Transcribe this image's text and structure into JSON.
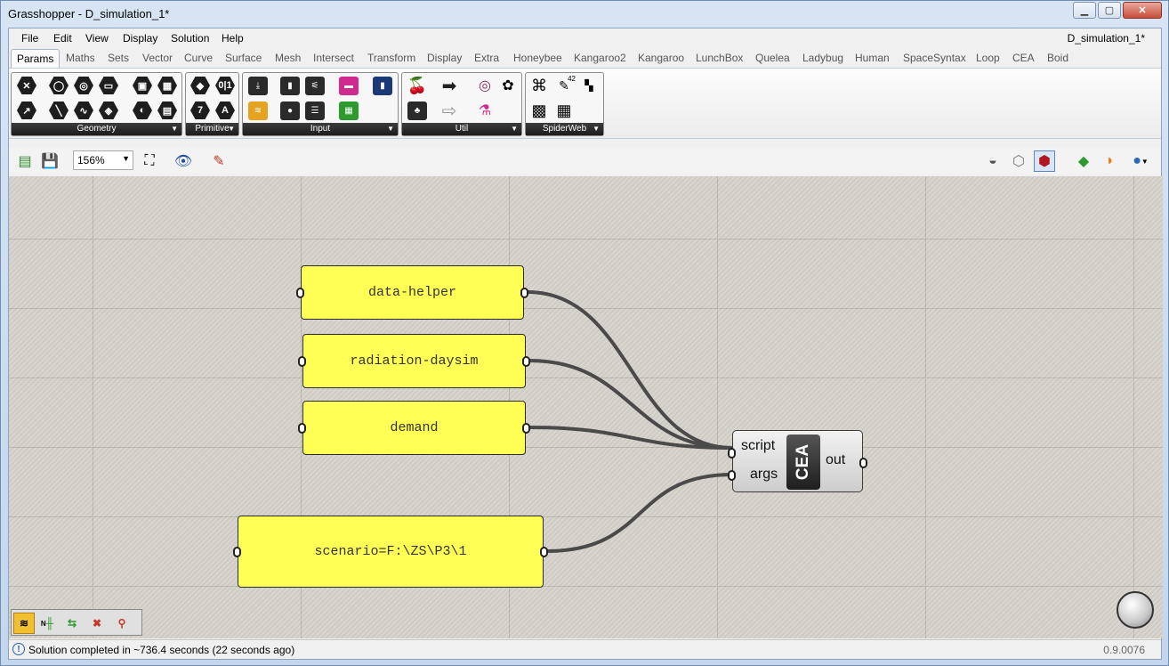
{
  "window": {
    "title": "Grasshopper - D_simulation_1*",
    "minimize_label": "▁",
    "maximize_label": "▢",
    "close_label": "✕"
  },
  "menu": {
    "items": [
      "File",
      "Edit",
      "View",
      "Display",
      "Solution",
      "Help"
    ],
    "document_name": "D_simulation_1*"
  },
  "tabs": [
    "Params",
    "Maths",
    "Sets",
    "Vector",
    "Curve",
    "Surface",
    "Mesh",
    "Intersect",
    "Transform",
    "Display",
    "Extra",
    "Honeybee",
    "Kangaroo2",
    "Kangaroo",
    "LunchBox",
    "Quelea",
    "Ladybug",
    "Human",
    "SpaceSyntax",
    "Loop",
    "CEA",
    "Boid"
  ],
  "active_tab": "Params",
  "ribbon": {
    "panels": [
      "Geometry",
      "Primitive",
      "Input",
      "Util",
      "SpiderWeb"
    ],
    "primitive_glyphs": [
      "0|1",
      "7",
      "A"
    ],
    "spiderweb_badge": "42"
  },
  "toolbar": {
    "zoom": "156%"
  },
  "canvas": {
    "panels": [
      "data-helper",
      "radiation-daysim",
      "demand",
      "scenario=F:\\ZS\\P3\\1"
    ],
    "component": {
      "name": "CEA",
      "inputs": [
        "script",
        "args"
      ],
      "outputs": [
        "out"
      ]
    },
    "widget_n_label": "N"
  },
  "status": {
    "message": "Solution completed in ~736.4 seconds (22 seconds ago)",
    "info_glyph": "!",
    "version": "0.9.0076"
  },
  "colors": {
    "panel_fill": "#ffff55",
    "canvas_bg": "#d5d1ca",
    "wire": "#4a4a4a",
    "ribbon_label_bg": "#1c1c1c"
  }
}
